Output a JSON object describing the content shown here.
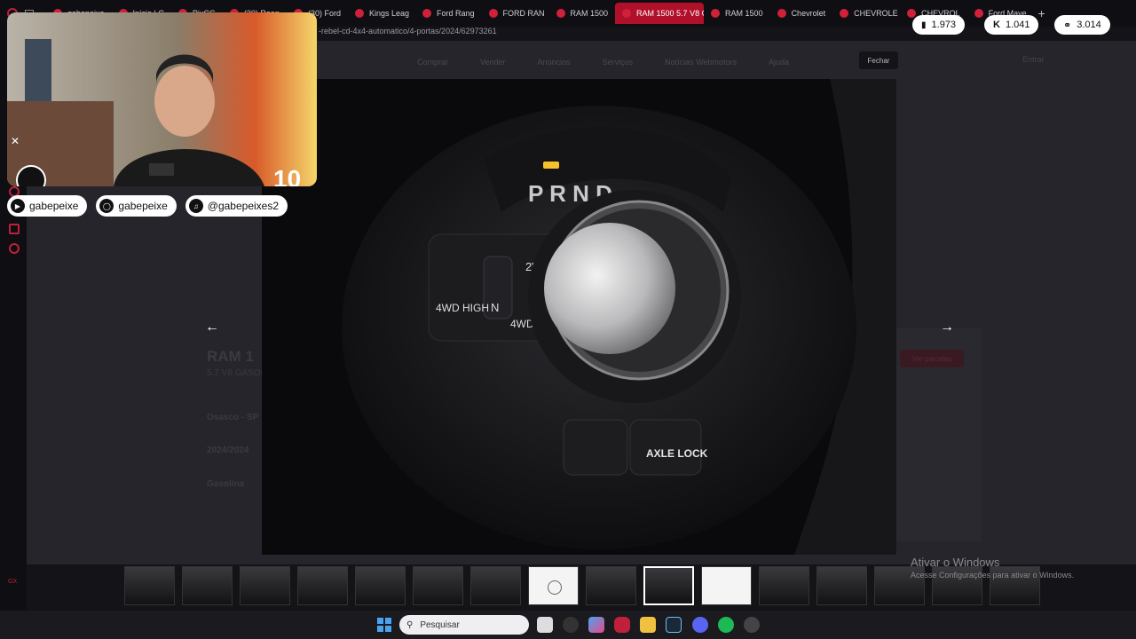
{
  "tabs": [
    {
      "label": "gabepeixe"
    },
    {
      "label": "Início | C"
    },
    {
      "label": "PixCG"
    },
    {
      "label": "(30) Rean"
    },
    {
      "label": "(30) Ford"
    },
    {
      "label": "Kings Leag"
    },
    {
      "label": "Ford Rang"
    },
    {
      "label": "FORD RAN"
    },
    {
      "label": "RAM 1500"
    },
    {
      "label": "RAM 1500 5.7 V8 G",
      "active": true
    },
    {
      "label": "RAM 1500"
    },
    {
      "label": "Chevrolet"
    },
    {
      "label": "CHEVROLE"
    },
    {
      "label": "CHEVROL"
    },
    {
      "label": "Ford Mave"
    }
  ],
  "url": "-rebel-cd-4x4-automatico/4-portas/2024/62973261",
  "site": {
    "nav": [
      "Comprar",
      "Vender",
      "Anúncios",
      "Serviços",
      "Notícias Webmotors",
      "Ajuda"
    ],
    "close_label": "Fechar",
    "entrar": "Entrar",
    "bg_title": "RAM 1",
    "bg_sub": "5.7 V8 GASOL",
    "bg_loc": "Osasco - SP",
    "bg_year": "2024/2024",
    "bg_fuel": "Gasolina",
    "bg_btn": "Ver parcelas"
  },
  "viewer": {
    "prev_icon": "arrow-left-icon",
    "next_icon": "arrow-right-icon",
    "photo_text": {
      "gear": "P R N D",
      "two": "2WD",
      "n": "N",
      "hi": "4WD HIGH",
      "lo": "4WD LOW",
      "axle": "AXLE LOCK"
    }
  },
  "thumbnails": [
    {
      "type": "dark"
    },
    {
      "type": "dark"
    },
    {
      "type": "dark"
    },
    {
      "type": "dark"
    },
    {
      "type": "dark"
    },
    {
      "type": "dark"
    },
    {
      "type": "dark"
    },
    {
      "type": "light-ring"
    },
    {
      "type": "dark"
    },
    {
      "type": "dark",
      "selected": true
    },
    {
      "type": "light"
    },
    {
      "type": "dark"
    },
    {
      "type": "dark"
    },
    {
      "type": "dark"
    },
    {
      "type": "dark"
    },
    {
      "type": "dark"
    }
  ],
  "watermark": {
    "title": "Ativar o Windows",
    "sub": "Acesse Configurações para ativar o Windows."
  },
  "stream": {
    "badge": "10",
    "socials": [
      {
        "icon": "youtube-icon",
        "label": "gabepeixe"
      },
      {
        "icon": "instagram-icon",
        "label": "gabepeixe"
      },
      {
        "icon": "tiktok-icon",
        "label": "@gabepeixes2"
      }
    ],
    "counters": [
      {
        "icon": "twitch-icon",
        "value": "1.973"
      },
      {
        "icon": "kick-icon",
        "value": "1.041"
      },
      {
        "icon": "globe-icon",
        "value": "3.014"
      }
    ]
  },
  "taskbar": {
    "search_label": "Pesquisar"
  }
}
